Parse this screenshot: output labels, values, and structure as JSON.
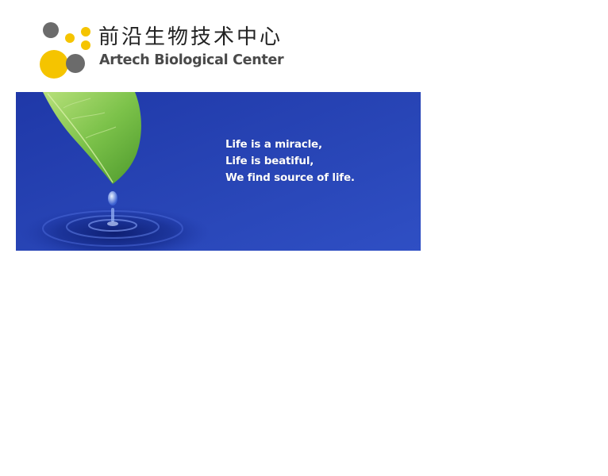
{
  "header": {
    "logo_cn": "前沿生物技术中心",
    "logo_en": "Artech Biological Center"
  },
  "banner": {
    "lines": [
      "Life is a miracle,",
      "Life is beatiful,",
      "We find source of life."
    ],
    "illustration": "leaf-water-drop",
    "background_color": "#2a45b8"
  },
  "colors": {
    "brand_yellow": "#f5c400",
    "brand_gray": "#6b6b6b"
  }
}
